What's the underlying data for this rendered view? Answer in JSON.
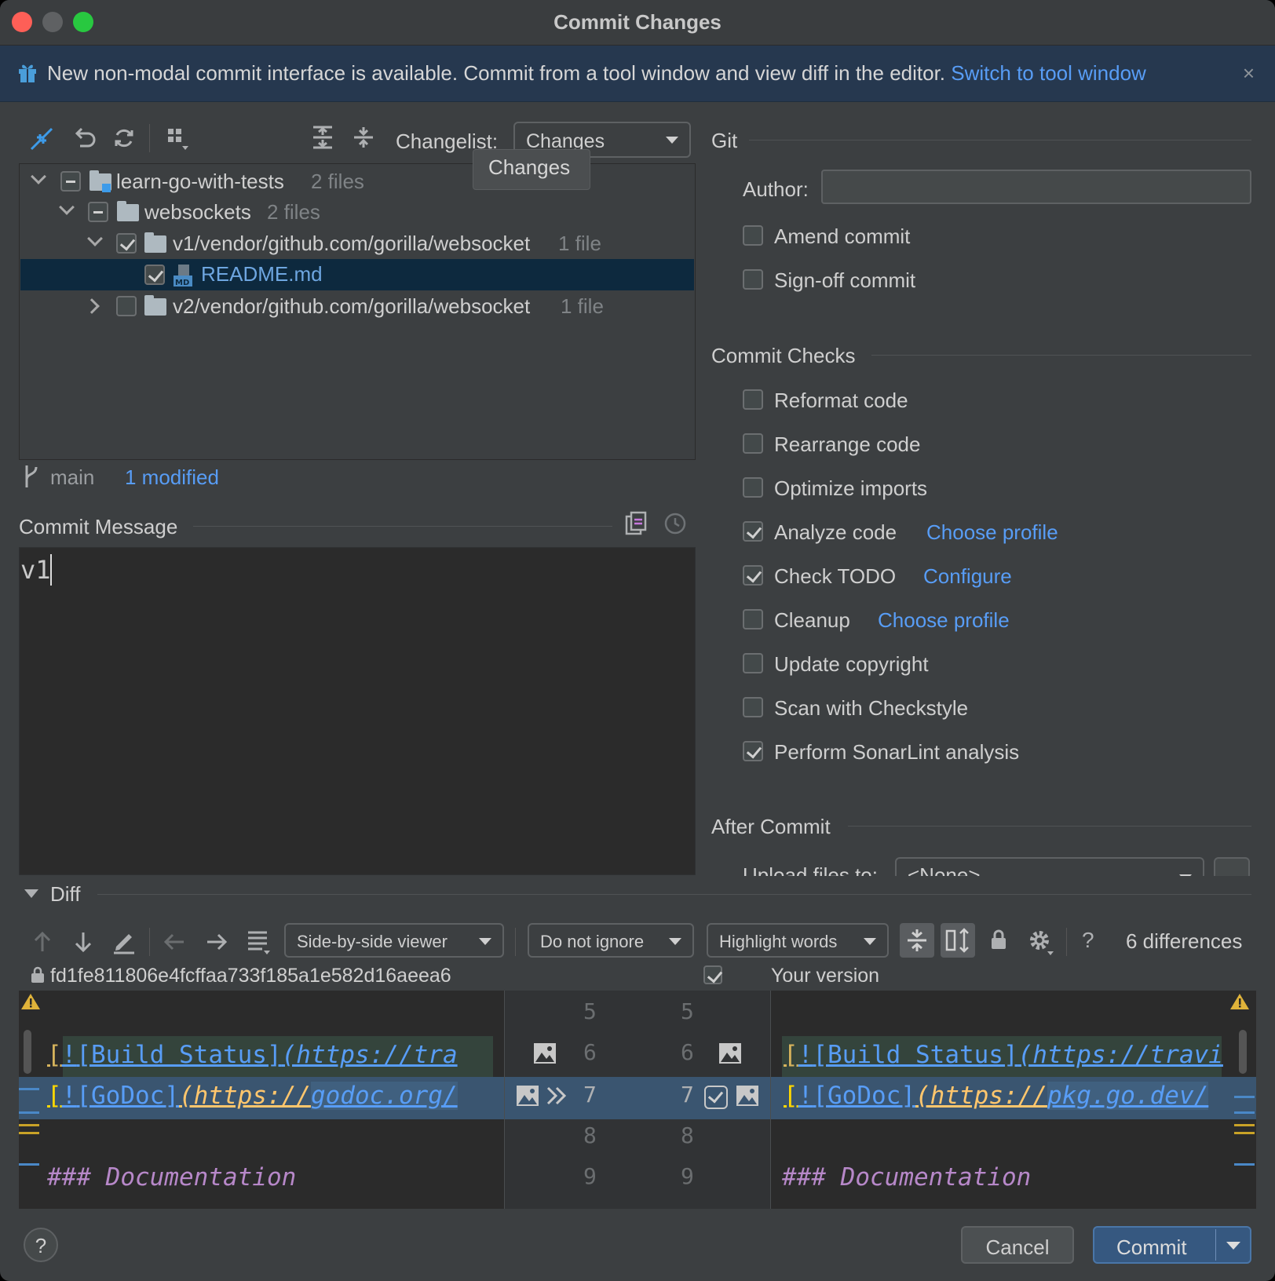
{
  "window": {
    "title": "Commit Changes"
  },
  "banner": {
    "message": "New non-modal commit interface is available. Commit from a tool window and view diff in the editor.",
    "link": "Switch to tool window",
    "close": "×"
  },
  "changes": {
    "changelist_label": "Changelist:",
    "changelist_value": "Changes",
    "tooltip": "Changes",
    "tree": [
      {
        "name": "learn-go-with-tests",
        "meta": "2 files"
      },
      {
        "name": "websockets",
        "meta": "2 files"
      },
      {
        "name": "v1/vendor/github.com/gorilla/websocket",
        "meta": "1 file"
      },
      {
        "name": "README.md",
        "meta": ""
      },
      {
        "name": "v2/vendor/github.com/gorilla/websocket",
        "meta": "1 file"
      }
    ],
    "branch": "main",
    "modified": "1 modified"
  },
  "commit_message": {
    "label": "Commit Message",
    "value": "v1"
  },
  "git": {
    "section": "Git",
    "author_label": "Author:",
    "author_value": "",
    "amend": "Amend commit",
    "signoff": "Sign-off commit"
  },
  "checks": {
    "section": "Commit Checks",
    "items": [
      {
        "label": "Reformat code",
        "checked": false,
        "link": ""
      },
      {
        "label": "Rearrange code",
        "checked": false,
        "link": ""
      },
      {
        "label": "Optimize imports",
        "checked": false,
        "link": ""
      },
      {
        "label": "Analyze code",
        "checked": true,
        "link": "Choose profile"
      },
      {
        "label": "Check TODO",
        "checked": true,
        "link": "Configure"
      },
      {
        "label": "Cleanup",
        "checked": false,
        "link": "Choose profile"
      },
      {
        "label": "Update copyright",
        "checked": false,
        "link": ""
      },
      {
        "label": "Scan with Checkstyle",
        "checked": false,
        "link": ""
      },
      {
        "label": "Perform SonarLint analysis",
        "checked": true,
        "link": ""
      }
    ]
  },
  "after_commit": {
    "section": "After Commit",
    "upload_label": "Upload files to:",
    "upload_value": "<None>"
  },
  "diff": {
    "section": "Diff",
    "viewer": "Side-by-side viewer",
    "ignore": "Do not ignore",
    "highlight": "Highlight words",
    "differences": "6 differences",
    "left_title": "fd1fe811806e4fcffaa733f185a1e582d16aeea6",
    "right_title": "Your version",
    "line_numbers": [
      "5",
      "6",
      "7",
      "8",
      "9"
    ],
    "left": {
      "l6_a": "[",
      "l6_b": "!",
      "l6_c": "[Build Status]",
      "l6_d": "(https://tra",
      "l7_a": "[",
      "l7_b": "!",
      "l7_c": "[GoDoc]",
      "l7_d": "(https://",
      "l7_e": "godoc.org/",
      "l9": "### Documentation"
    },
    "right": {
      "l6_a": "[",
      "l6_b": "!",
      "l6_c": "[Build Status]",
      "l6_d": "(https://travi",
      "l7_a": "[",
      "l7_b": "!",
      "l7_c": "[GoDoc]",
      "l7_d": "(https://",
      "l7_e": "pkg.go.dev/",
      "l9": "### Documentation"
    }
  },
  "buttons": {
    "help": "?",
    "cancel": "Cancel",
    "commit": "Commit"
  },
  "colors": {
    "accent": "#589df6",
    "selection": "#0d293e",
    "primary_button": "#365880"
  }
}
